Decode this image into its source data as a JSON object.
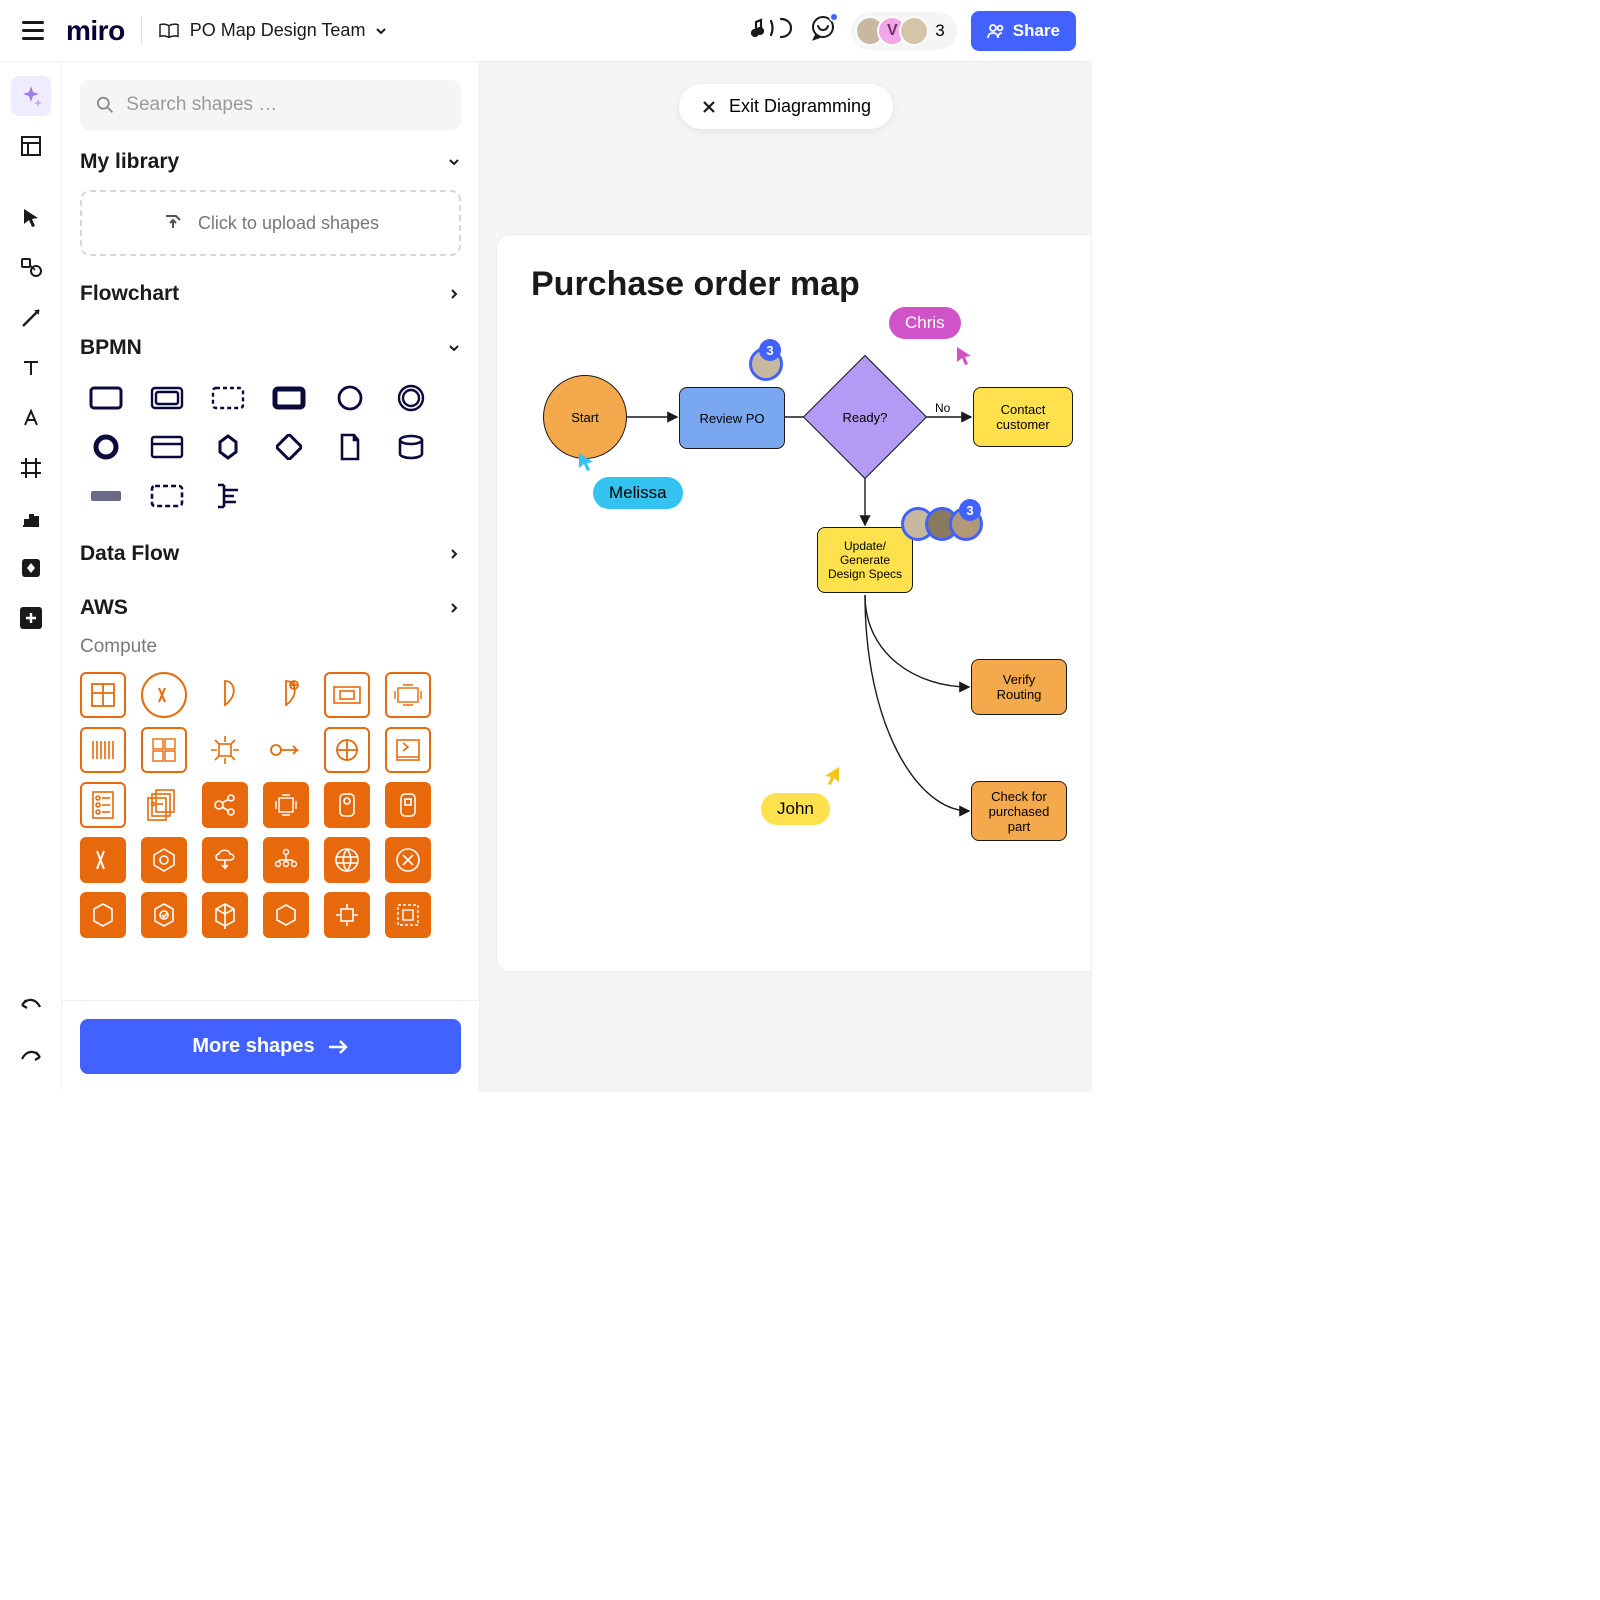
{
  "topbar": {
    "logo": "miro",
    "board_name": "PO Map Design Team",
    "avatar_count": "3",
    "share_label": "Share"
  },
  "panel": {
    "search_placeholder": "Search shapes …",
    "my_library": "My library",
    "upload_hint": "Click to upload shapes",
    "flowchart": "Flowchart",
    "bpmn": "BPMN",
    "data_flow": "Data Flow",
    "aws": "AWS",
    "aws_sub": "Compute",
    "more_shapes": "More shapes"
  },
  "canvas": {
    "exit_label": "Exit Diagramming",
    "title": "Purchase order map",
    "nodes": {
      "start": "Start",
      "review": "Review PO",
      "decision": "Ready?",
      "contact": "Contact customer",
      "specs": "Update/\nGenerate Design Specs",
      "verify": "Verify Routing",
      "check": "Check for purchased part"
    },
    "edges": {
      "no": "No"
    },
    "cursors": {
      "melissa": "Melissa",
      "chris": "Chris",
      "john": "John"
    },
    "badges": {
      "top": "3",
      "mid": "3"
    }
  }
}
